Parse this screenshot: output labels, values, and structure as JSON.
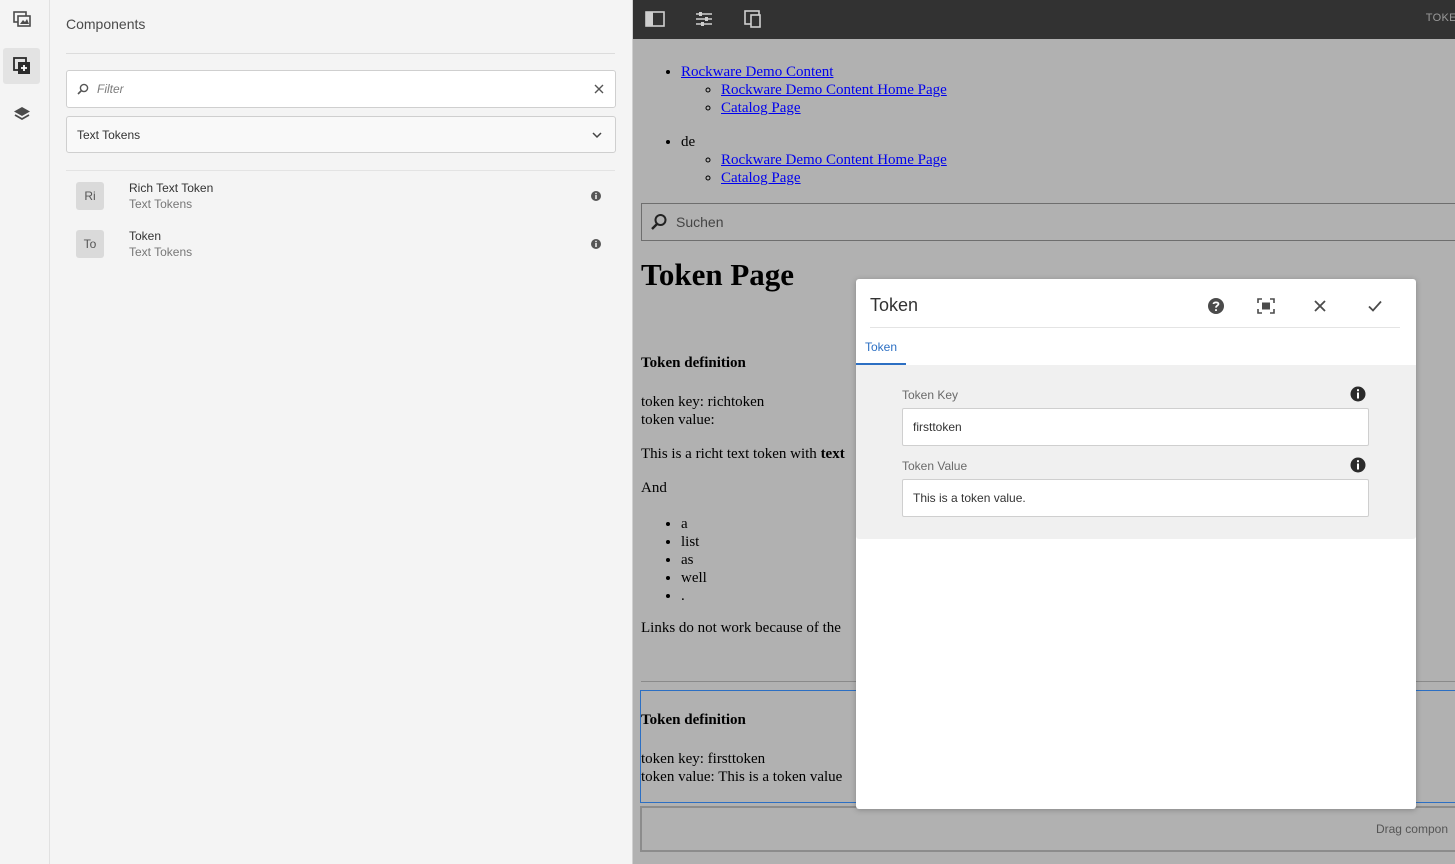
{
  "rail": {
    "items": [
      {
        "name": "assets-icon"
      },
      {
        "name": "components-icon"
      },
      {
        "name": "layers-icon"
      }
    ]
  },
  "panel": {
    "title": "Components",
    "filter_placeholder": "Filter",
    "group_select": "Text Tokens",
    "components": [
      {
        "badge": "Ri",
        "name": "Rich Text Token",
        "group": "Text Tokens"
      },
      {
        "badge": "To",
        "name": "Token",
        "group": "Text Tokens"
      }
    ]
  },
  "topbar": {
    "title": "TOKEN"
  },
  "page": {
    "nav": [
      {
        "label": "Rockware Demo Content",
        "children": [
          "Rockware Demo Content Home Page",
          "Catalog Page"
        ]
      },
      {
        "label": "de",
        "children": [
          "Rockware Demo Content Home Page",
          "Catalog Page"
        ]
      }
    ],
    "search_placeholder": "Suchen",
    "heading": "Token Page",
    "def1_title": "Token definition",
    "def1_key": "token key: richtoken",
    "def1_value": "token value:",
    "rich_text_prefix": "This is a richt text token with ",
    "rich_text_bold": "text",
    "and_text": "And",
    "list": [
      "a",
      "list",
      "as",
      "well",
      "."
    ],
    "links_text": "Links do not work because of the",
    "def2_title": "Token definition",
    "def2_key": "token key: firsttoken",
    "def2_value": "token value: This is a token value",
    "drag_text": "Drag compon"
  },
  "dialog": {
    "title": "Token",
    "tab": "Token",
    "fields": [
      {
        "label": "Token Key",
        "value": "firsttoken"
      },
      {
        "label": "Token Value",
        "value": "This is a token value."
      }
    ]
  }
}
